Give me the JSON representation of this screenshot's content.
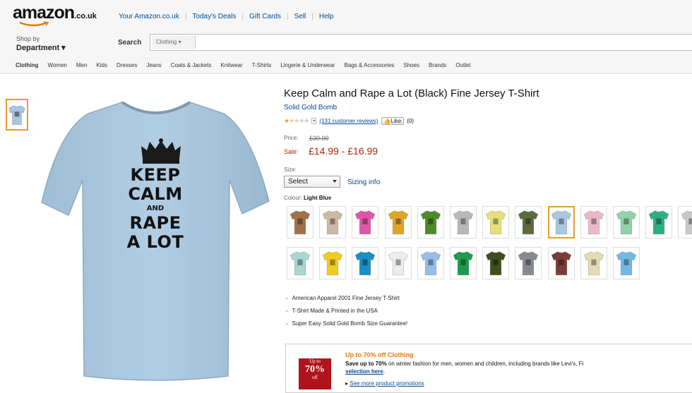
{
  "header": {
    "logo": "amazon",
    "logo_tld": ".co.uk",
    "top_links": [
      "Your Amazon.co.uk",
      "Today's Deals",
      "Gift Cards",
      "Sell",
      "Help"
    ],
    "shop_by": "Shop by",
    "department": "Department",
    "search_label": "Search",
    "search_category": "Clothing"
  },
  "subnav": [
    "Clothing",
    "Women",
    "Men",
    "Kids",
    "Dresses",
    "Jeans",
    "Coats & Jackets",
    "Knitwear",
    "T-Shirts",
    "Lingerie & Underwear",
    "Bags & Accessories",
    "Shoes",
    "Brands",
    "Outlet"
  ],
  "main_image": {
    "line1": "KEEP",
    "line2": "CALM",
    "line3": "AND",
    "line4": "RAPE",
    "line5": "A LOT"
  },
  "product": {
    "title": "Keep Calm and Rape a Lot (Black) Fine Jersey T-Shirt",
    "brand": "Solid Gold Bomb",
    "rating_stars": 1.5,
    "reviews": "(131 customer reviews)",
    "like": "Like",
    "like_count": "(0)",
    "price_label": "Price:",
    "price_old": "£30.00",
    "sale_label": "Sale:",
    "sale_price": "£14.99 - £16.99",
    "size_label": "Size:",
    "size_value": "Select",
    "sizing_info": "Sizing info",
    "colour_label": "Colour:",
    "colour_value": "Light Blue"
  },
  "swatch_colors": [
    "#a0704a",
    "#cbb9a5",
    "#e056a6",
    "#e0a428",
    "#4f8a2a",
    "#b8b8bc",
    "#e6df7a",
    "#5c6b3c",
    "#a9c7df",
    "#eab8cc",
    "#8fd3a8",
    "#2fae86",
    "#c9c9c9",
    "#a8d6d0",
    "#f0cc20",
    "#1a8ec6",
    "#ececec",
    "#96bde8",
    "#1d9a4e",
    "#3e4e1e",
    "#868a8e",
    "#7a3c36",
    "#e4dbb4",
    "#74b8e6"
  ],
  "selected_swatch": 8,
  "bullets": [
    "American Apparel 2001 Fine Jersey T-Shirt",
    "T-Shirt Made & Printed in the USA",
    "Super Easy Solid Gold Bomb Size Guarantee!"
  ],
  "promo": {
    "image_top": "Up to",
    "image_pct": "70%",
    "image_bottom": "off",
    "headline": "Up to 70% off Clothing",
    "body_bold": "Save up to 70%",
    "body": " on winter fashion for men, women and children, including brands like Levi's, Fi",
    "body_link": "selection here",
    "link": "See more product promotions"
  },
  "colors": {
    "shirt": "#a9c7df",
    "sale_red": "#b12704",
    "link_blue": "#004b91",
    "accent_orange": "#e0a030"
  }
}
